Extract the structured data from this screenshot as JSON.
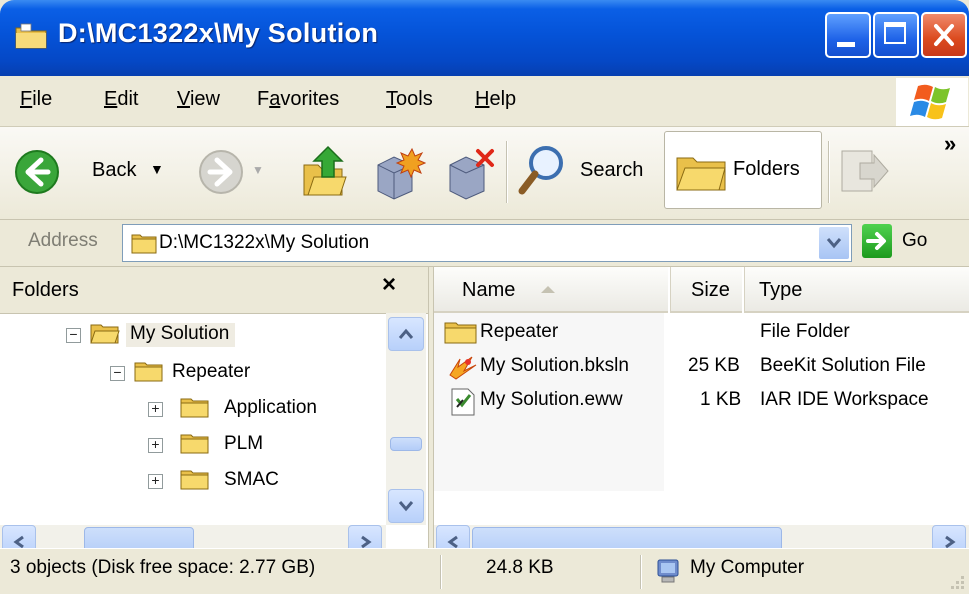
{
  "window": {
    "title": "D:\\MC1322x\\My Solution",
    "controls": {
      "minimize": "minimize",
      "maximize": "maximize",
      "close": "close"
    }
  },
  "menu": [
    {
      "pre": "",
      "u": "F",
      "post": "ile"
    },
    {
      "pre": "",
      "u": "E",
      "post": "dit"
    },
    {
      "pre": "",
      "u": "V",
      "post": "iew"
    },
    {
      "pre": "F",
      "u": "a",
      "post": "vorites"
    },
    {
      "pre": "",
      "u": "T",
      "post": "ools"
    },
    {
      "pre": "",
      "u": "H",
      "post": "elp"
    }
  ],
  "toolbar": {
    "back_label": "Back",
    "search_label": "Search",
    "folders_label": "Folders",
    "overflow": "»"
  },
  "address": {
    "label": "Address",
    "path": "D:\\MC1322x\\My Solution",
    "go_label": "Go"
  },
  "folders_pane": {
    "title": "Folders",
    "close_glyph": "×",
    "tree": [
      {
        "label": "My Solution",
        "expander": "−"
      },
      {
        "label": "Repeater",
        "expander": "−"
      },
      {
        "label": "Application",
        "expander": "+"
      },
      {
        "label": "PLM",
        "expander": "+"
      },
      {
        "label": "SMAC",
        "expander": "+"
      }
    ]
  },
  "file_list": {
    "columns": {
      "name": "Name",
      "size": "Size",
      "type": "Type"
    },
    "rows": [
      {
        "name": "Repeater",
        "size": "",
        "type": "File Folder",
        "icon": "folder-icon"
      },
      {
        "name": "My Solution.bksln",
        "size": "25 KB",
        "type": "BeeKit Solution File",
        "icon": "beekit-file-icon"
      },
      {
        "name": "My Solution.eww",
        "size": "1 KB",
        "type": "IAR IDE Workspace",
        "icon": "iar-workspace-icon"
      }
    ]
  },
  "status": {
    "objects": "3 objects (Disk free space: 2.77 GB)",
    "size": "24.8 KB",
    "zone": "My Computer"
  },
  "colors": {
    "titlebar": "#0553d8",
    "folder": "#f2c64a",
    "selection": "#efece2"
  }
}
